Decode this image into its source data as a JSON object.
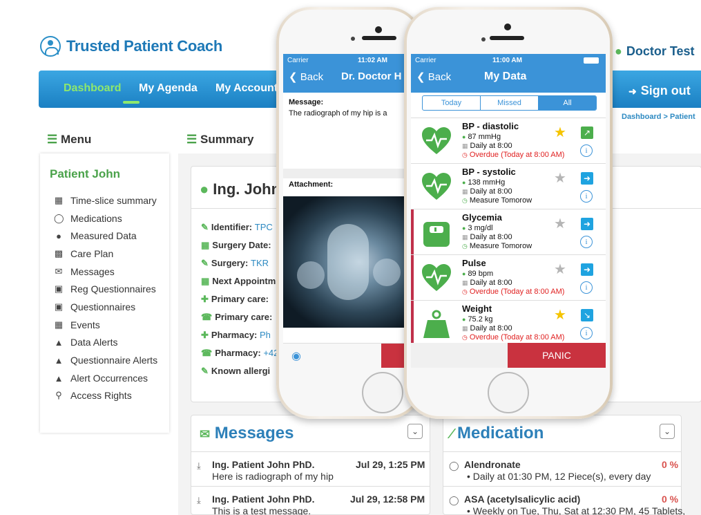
{
  "app": {
    "logo_text": "Trusted Patient Coach",
    "user_name": "Doctor Test",
    "signout_label": "Sign out"
  },
  "nav": {
    "items": [
      "Dashboard",
      "My Agenda",
      "My Account"
    ]
  },
  "breadcrumb": "Dashboard > Patient",
  "menu": {
    "header": "Menu",
    "patient_title": "Patient John",
    "items": [
      {
        "label": "Time-slice summary",
        "icon": "calendar-icon"
      },
      {
        "label": "Medications",
        "icon": "pill-icon"
      },
      {
        "label": "Measured Data",
        "icon": "gauge-icon"
      },
      {
        "label": "Care Plan",
        "icon": "chart-icon"
      },
      {
        "label": "Messages",
        "icon": "envelope-icon"
      },
      {
        "label": "Reg Questionnaires",
        "icon": "clipboard-icon"
      },
      {
        "label": "Questionnaires",
        "icon": "clipboard-icon"
      },
      {
        "label": "Events",
        "icon": "calendar-icon"
      },
      {
        "label": "Data Alerts",
        "icon": "warning-icon"
      },
      {
        "label": "Questionnaire Alerts",
        "icon": "warning-icon"
      },
      {
        "label": "Alert Occurrences",
        "icon": "warning-icon"
      },
      {
        "label": "Access Rights",
        "icon": "key-icon"
      }
    ]
  },
  "summary": {
    "header": "Summary",
    "patient_name": "Ing. John",
    "fields": [
      {
        "label": "Identifier:",
        "value": "TPC"
      },
      {
        "label": "Surgery Date:",
        "value": ""
      },
      {
        "label": "Surgery:",
        "value": "TKR"
      },
      {
        "label": "Next Appointm",
        "value": ""
      },
      {
        "label": "Primary care:",
        "value": ""
      },
      {
        "label": "Primary care:",
        "value": ""
      },
      {
        "label": "Pharmacy:",
        "value": "Ph"
      },
      {
        "label": "Pharmacy:",
        "value": "+42"
      },
      {
        "label": "Known allergi",
        "value": ""
      }
    ]
  },
  "messages": {
    "title": "Messages",
    "rows": [
      {
        "sender": "Ing. Patient John PhD.",
        "date": "Jul 29, 1:25 PM",
        "text": "Here is radiograph of my hip"
      },
      {
        "sender": "Ing. Patient John PhD.",
        "date": "Jul 29, 12:58 PM",
        "text": "This is a test message."
      }
    ]
  },
  "medication": {
    "title": "Medication",
    "rows": [
      {
        "name": "Alendronate",
        "pct": "0 %",
        "detail": "• Daily at 01:30 PM, 12 Piece(s), every day"
      },
      {
        "name": "ASA (acetylsalicylic acid)",
        "pct": "0 %",
        "detail": "• Weekly on Tue, Thu, Sat at 12:30 PM, 45 Tablets,"
      }
    ]
  },
  "phone1": {
    "carrier": "Carrier",
    "time": "11:02 AM",
    "back": "Back",
    "title": "Dr. Doctor H",
    "message_label": "Message:",
    "message_text": "The radiograph of my hip is a",
    "attachment_label": "Attachment:"
  },
  "phone2": {
    "carrier": "Carrier",
    "time": "11:00 AM",
    "back": "Back",
    "title": "My Data",
    "tabs": [
      "Today",
      "Missed",
      "All"
    ],
    "active_tab": "All",
    "panic_label": "PANIC",
    "items": [
      {
        "name": "BP - diastolic",
        "value": "87 mmHg",
        "schedule": "Daily at 8:00",
        "status": "Overdue (Today at 8:00 AM)",
        "overdue": true,
        "starred": true,
        "trend": "up",
        "flag": false
      },
      {
        "name": "BP - systolic",
        "value": "138 mmHg",
        "schedule": "Daily at 8:00",
        "status": "Measure Tomorow",
        "overdue": false,
        "starred": false,
        "trend": "flat",
        "flag": false
      },
      {
        "name": "Glycemia",
        "value": "3 mg/dl",
        "schedule": "Daily at 8:00",
        "status": "Measure Tomorow",
        "overdue": false,
        "starred": false,
        "trend": "flat",
        "flag": true
      },
      {
        "name": "Pulse",
        "value": "89 bpm",
        "schedule": "Daily at 8:00",
        "status": "Overdue (Today at 8:00 AM)",
        "overdue": true,
        "starred": false,
        "trend": "flat",
        "flag": true
      },
      {
        "name": "Weight",
        "value": "75.2 kg",
        "schedule": "Daily at 8:00",
        "status": "Overdue (Today at 8:00 AM)",
        "overdue": true,
        "starred": true,
        "trend": "down",
        "flag": true
      }
    ]
  },
  "colors": {
    "accent": "#1b80c3",
    "nav_active": "#8ee86d",
    "green": "#4cae4c",
    "alert_red": "#c9323f",
    "star_gold": "#f5c400",
    "star_grey": "#b5b5b5"
  }
}
